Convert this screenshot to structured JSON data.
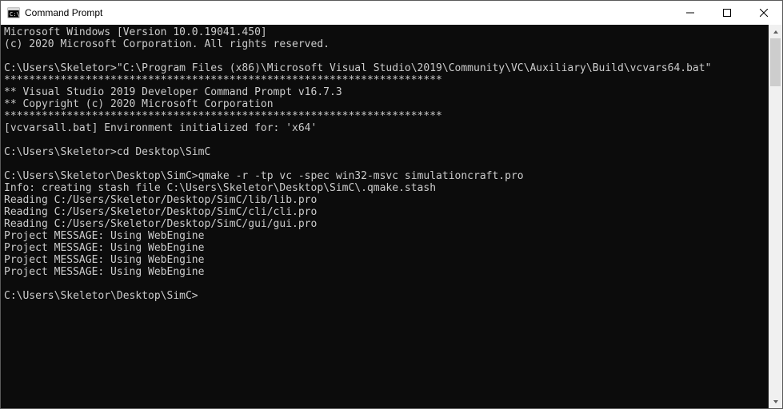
{
  "titlebar": {
    "title": "Command Prompt"
  },
  "terminal": {
    "lines": [
      "Microsoft Windows [Version 10.0.19041.450]",
      "(c) 2020 Microsoft Corporation. All rights reserved.",
      "",
      "C:\\Users\\Skeletor>\"C:\\Program Files (x86)\\Microsoft Visual Studio\\2019\\Community\\VC\\Auxiliary\\Build\\vcvars64.bat\"",
      "**********************************************************************",
      "** Visual Studio 2019 Developer Command Prompt v16.7.3",
      "** Copyright (c) 2020 Microsoft Corporation",
      "**********************************************************************",
      "[vcvarsall.bat] Environment initialized for: 'x64'",
      "",
      "C:\\Users\\Skeletor>cd Desktop\\SimC",
      "",
      "C:\\Users\\Skeletor\\Desktop\\SimC>qmake -r -tp vc -spec win32-msvc simulationcraft.pro",
      "Info: creating stash file C:\\Users\\Skeletor\\Desktop\\SimC\\.qmake.stash",
      "Reading C:/Users/Skeletor/Desktop/SimC/lib/lib.pro",
      "Reading C:/Users/Skeletor/Desktop/SimC/cli/cli.pro",
      "Reading C:/Users/Skeletor/Desktop/SimC/gui/gui.pro",
      "Project MESSAGE: Using WebEngine",
      "Project MESSAGE: Using WebEngine",
      "Project MESSAGE: Using WebEngine",
      "Project MESSAGE: Using WebEngine",
      "",
      "C:\\Users\\Skeletor\\Desktop\\SimC>"
    ]
  }
}
